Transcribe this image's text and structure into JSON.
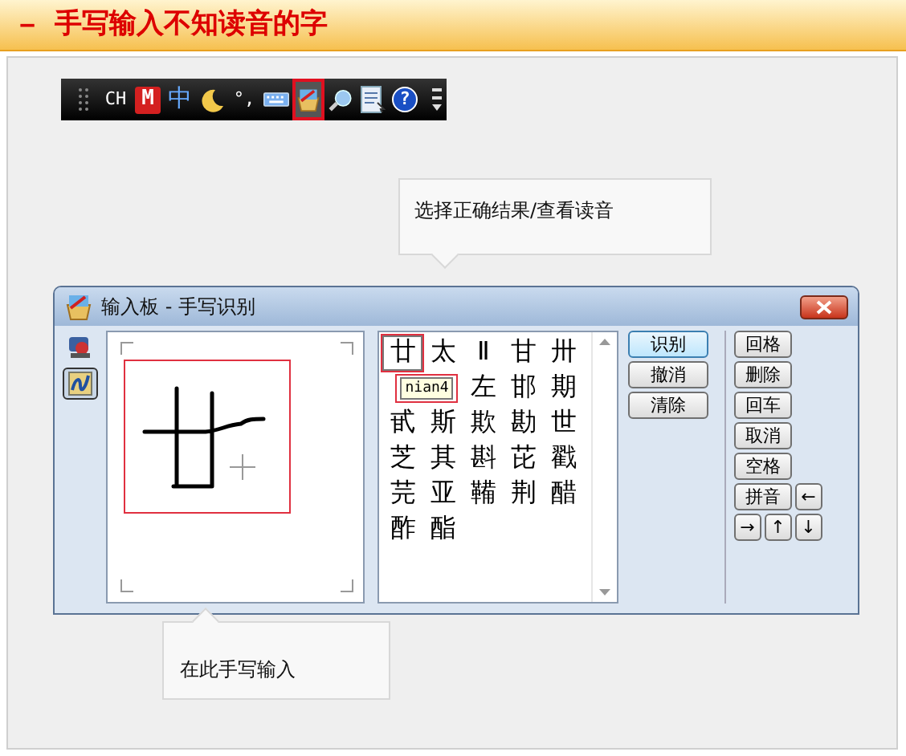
{
  "header": {
    "dash": "－",
    "title": "手写输入不知读音的字"
  },
  "toolbar": [
    {
      "kind": "grip",
      "selected": false
    },
    {
      "kind": "text",
      "label": "CH",
      "selected": false
    },
    {
      "kind": "badge",
      "label": "M",
      "selected": false
    },
    {
      "kind": "text",
      "label": "中",
      "selected": false
    },
    {
      "kind": "moon",
      "selected": false
    },
    {
      "kind": "text",
      "label": "°,",
      "selected": false
    },
    {
      "kind": "keyboard",
      "selected": false
    },
    {
      "kind": "pad",
      "selected": true
    },
    {
      "kind": "search",
      "selected": false
    },
    {
      "kind": "doc",
      "selected": false
    },
    {
      "kind": "help",
      "label": "?",
      "selected": false
    },
    {
      "kind": "menu",
      "selected": false
    }
  ],
  "callouts": [
    {
      "text": "选择正确结果/查看读音"
    },
    {
      "text": "在此手写输入"
    }
  ],
  "window": {
    "title": "输入板 - 手写识别",
    "tools": [
      {
        "kind": "pen",
        "selected": false
      },
      {
        "kind": "handwriting",
        "selected": true
      }
    ],
    "candidates": [
      {
        "char": "廿",
        "selected": true
      },
      {
        "char": "太",
        "selected": false
      },
      {
        "char": "Ⅱ",
        "selected": false
      },
      {
        "char": "甘",
        "selected": false
      },
      {
        "char": "卅",
        "selected": false
      },
      {
        "char": "左",
        "selected": false
      },
      {
        "char": "邯",
        "selected": false
      },
      {
        "char": "期",
        "selected": false
      },
      {
        "char": "甙",
        "selected": false
      },
      {
        "char": "斯",
        "selected": false
      },
      {
        "char": "欺",
        "selected": false
      },
      {
        "char": "勘",
        "selected": false
      },
      {
        "char": "世",
        "selected": false
      },
      {
        "char": "芝",
        "selected": false
      },
      {
        "char": "其",
        "selected": false
      },
      {
        "char": "斟",
        "selected": false
      },
      {
        "char": "芘",
        "selected": false
      },
      {
        "char": "戳",
        "selected": false
      },
      {
        "char": "芫",
        "selected": false
      },
      {
        "char": "亚",
        "selected": false
      },
      {
        "char": "鞴",
        "selected": false
      },
      {
        "char": "荆",
        "selected": false
      },
      {
        "char": "醋",
        "selected": false
      },
      {
        "char": "酢",
        "selected": false
      },
      {
        "char": "酯",
        "selected": false
      }
    ],
    "tooltip": "nian4",
    "actions": [
      {
        "label": "识别",
        "focused": true
      },
      {
        "label": "撤消",
        "focused": false
      },
      {
        "label": "清除",
        "focused": false
      }
    ],
    "keys": [
      {
        "label": "回格",
        "kind": "wide"
      },
      {
        "label": "删除",
        "kind": "wide"
      },
      {
        "label": "回车",
        "kind": "wide"
      },
      {
        "label": "取消",
        "kind": "wide"
      },
      {
        "label": "空格",
        "kind": "wide"
      },
      {
        "label": "拼音",
        "kind": "wide"
      },
      {
        "label": "←",
        "kind": "arrow"
      },
      {
        "label": "→",
        "kind": "arrow"
      },
      {
        "label": "↑",
        "kind": "arrow"
      },
      {
        "label": "↓",
        "kind": "arrow"
      }
    ]
  }
}
